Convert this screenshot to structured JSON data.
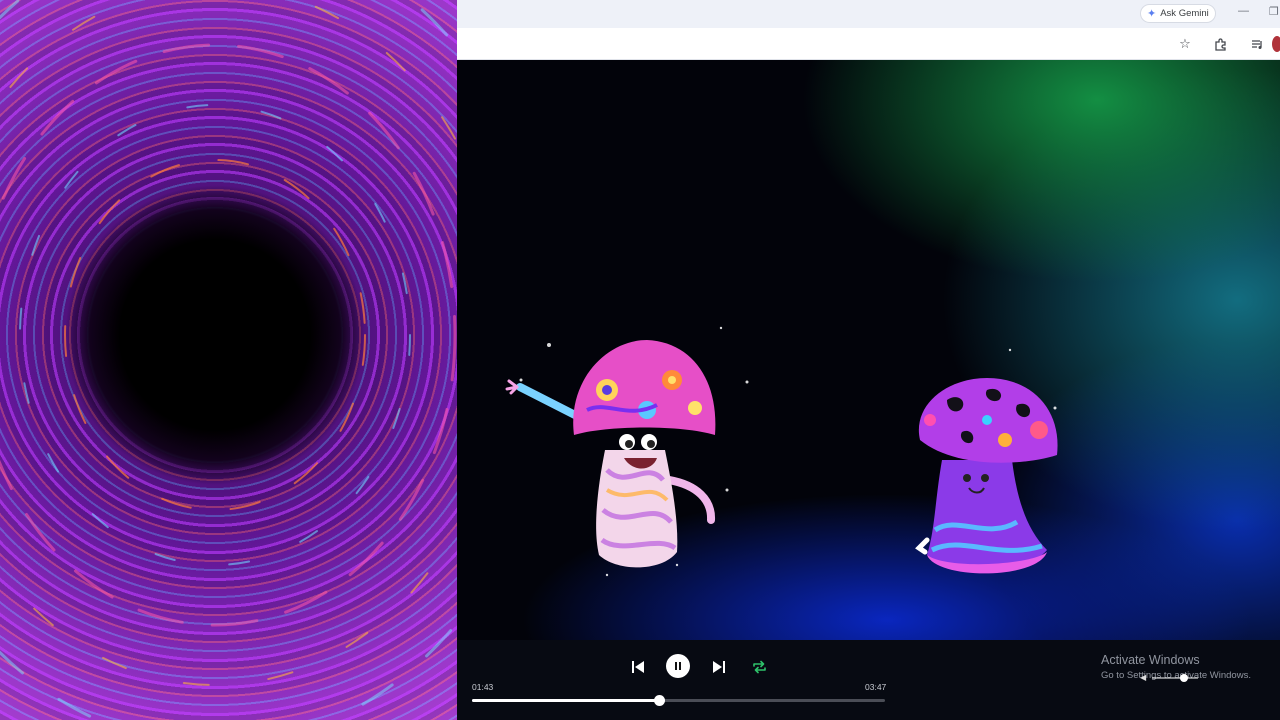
{
  "browser": {
    "ask_gemini_label": "Ask Gemini",
    "minimize_glyph": "—",
    "restore_glyph": "❐",
    "icons": [
      "star-icon",
      "extensions-icon",
      "media-queue-icon",
      "profile-icon"
    ]
  },
  "player": {
    "current_time": "01:43",
    "total_time": "03:47",
    "progress": 0.4537,
    "state": "playing",
    "repeat_active": true,
    "accent_color": "#2ec26a",
    "volume": 0.7
  },
  "watermark": {
    "title": "Activate Windows",
    "subtitle": "Go to Settings to activate Windows."
  }
}
